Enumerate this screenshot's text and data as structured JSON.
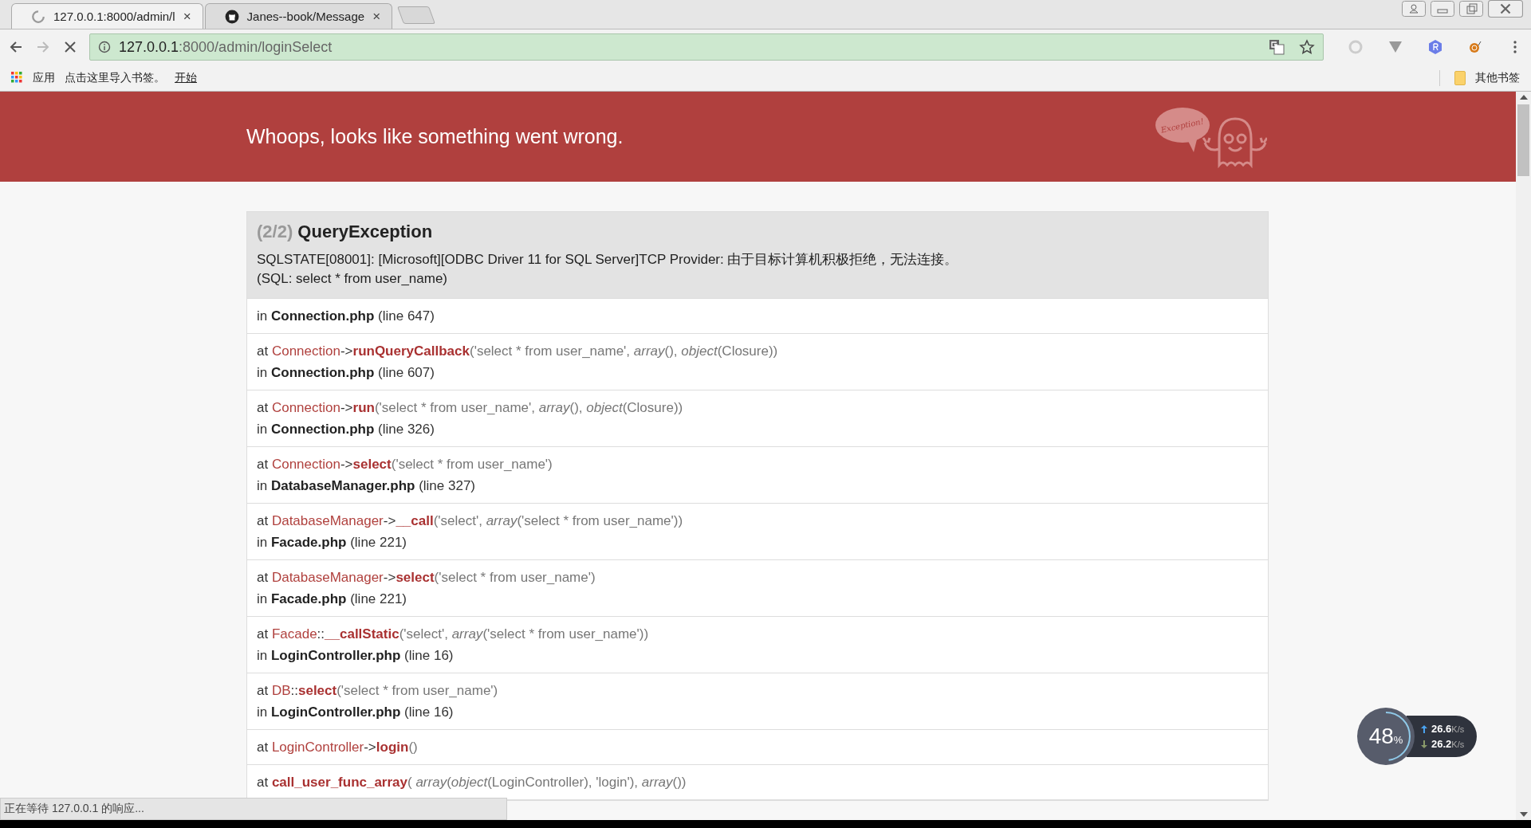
{
  "browser": {
    "tabs": [
      {
        "title": "127.0.0.1:8000/admin/l",
        "close": "×",
        "selected": true,
        "kind": "loading"
      },
      {
        "title": "Janes--book/Message",
        "close": "×",
        "selected": false,
        "kind": "github"
      }
    ],
    "address": {
      "host": "127.0.0.1",
      "path": ":8000/admin/loginSelect"
    },
    "bookmarks": [
      {
        "label": "应用",
        "kind": "apps"
      },
      {
        "label": "点击这里导入书签。",
        "kind": "text"
      },
      {
        "label": "开始",
        "kind": "link"
      }
    ],
    "other_bookmarks": "其他书签",
    "status": "正在等待 127.0.0.1 的响应..."
  },
  "header": {
    "message": "Whoops, looks like something went wrong.",
    "mascot_text": "Exception!"
  },
  "exception": {
    "counter": "(2/2)",
    "name": "QueryException",
    "message": "SQLSTATE[08001]: [Microsoft][ODBC Driver 11 for SQL Server]TCP Provider: 由于目标计算机积极拒绝，无法连接。",
    "sql": "(SQL: select * from user_name)"
  },
  "trace": [
    {
      "location": [
        {
          "text": "in ",
          "kind": "plain"
        },
        {
          "text": "Connection.php",
          "kind": "file"
        },
        {
          "text": " (line 647)",
          "kind": "plain"
        }
      ]
    },
    {
      "call": [
        {
          "text": "at ",
          "kind": "plain"
        },
        {
          "text": "Connection",
          "kind": "class"
        },
        {
          "text": "->",
          "kind": "sep"
        },
        {
          "text": "runQueryCallback",
          "kind": "method"
        },
        {
          "text": "('select * from user_name', ",
          "kind": "args"
        },
        {
          "text": "array",
          "kind": "italic"
        },
        {
          "text": "(), ",
          "kind": "args"
        },
        {
          "text": "object",
          "kind": "italic"
        },
        {
          "text": "(Closure))",
          "kind": "args"
        }
      ],
      "location": [
        {
          "text": "in ",
          "kind": "plain"
        },
        {
          "text": "Connection.php",
          "kind": "file"
        },
        {
          "text": " (line 607)",
          "kind": "plain"
        }
      ]
    },
    {
      "call": [
        {
          "text": "at ",
          "kind": "plain"
        },
        {
          "text": "Connection",
          "kind": "class"
        },
        {
          "text": "->",
          "kind": "sep"
        },
        {
          "text": "run",
          "kind": "method"
        },
        {
          "text": "('select * from user_name', ",
          "kind": "args"
        },
        {
          "text": "array",
          "kind": "italic"
        },
        {
          "text": "(), ",
          "kind": "args"
        },
        {
          "text": "object",
          "kind": "italic"
        },
        {
          "text": "(Closure))",
          "kind": "args"
        }
      ],
      "location": [
        {
          "text": "in ",
          "kind": "plain"
        },
        {
          "text": "Connection.php",
          "kind": "file"
        },
        {
          "text": " (line 326)",
          "kind": "plain"
        }
      ]
    },
    {
      "call": [
        {
          "text": "at ",
          "kind": "plain"
        },
        {
          "text": "Connection",
          "kind": "class"
        },
        {
          "text": "->",
          "kind": "sep"
        },
        {
          "text": "select",
          "kind": "method"
        },
        {
          "text": "('select * from user_name')",
          "kind": "args"
        }
      ],
      "location": [
        {
          "text": "in ",
          "kind": "plain"
        },
        {
          "text": "DatabaseManager.php",
          "kind": "file"
        },
        {
          "text": " (line 327)",
          "kind": "plain"
        }
      ]
    },
    {
      "call": [
        {
          "text": "at ",
          "kind": "plain"
        },
        {
          "text": "DatabaseManager",
          "kind": "class"
        },
        {
          "text": "->",
          "kind": "sep"
        },
        {
          "text": "__call",
          "kind": "method"
        },
        {
          "text": "('select', ",
          "kind": "args"
        },
        {
          "text": "array",
          "kind": "italic"
        },
        {
          "text": "('select * from user_name'))",
          "kind": "args"
        }
      ],
      "location": [
        {
          "text": "in ",
          "kind": "plain"
        },
        {
          "text": "Facade.php",
          "kind": "file"
        },
        {
          "text": " (line 221)",
          "kind": "plain"
        }
      ]
    },
    {
      "call": [
        {
          "text": "at ",
          "kind": "plain"
        },
        {
          "text": "DatabaseManager",
          "kind": "class"
        },
        {
          "text": "->",
          "kind": "sep"
        },
        {
          "text": "select",
          "kind": "method"
        },
        {
          "text": "('select * from user_name')",
          "kind": "args"
        }
      ],
      "location": [
        {
          "text": "in ",
          "kind": "plain"
        },
        {
          "text": "Facade.php",
          "kind": "file"
        },
        {
          "text": " (line 221)",
          "kind": "plain"
        }
      ]
    },
    {
      "call": [
        {
          "text": "at ",
          "kind": "plain"
        },
        {
          "text": "Facade",
          "kind": "class"
        },
        {
          "text": "::",
          "kind": "sep"
        },
        {
          "text": "__callStatic",
          "kind": "method"
        },
        {
          "text": "('select', ",
          "kind": "args"
        },
        {
          "text": "array",
          "kind": "italic"
        },
        {
          "text": "('select * from user_name'))",
          "kind": "args"
        }
      ],
      "location": [
        {
          "text": "in ",
          "kind": "plain"
        },
        {
          "text": "LoginController.php",
          "kind": "file"
        },
        {
          "text": " (line 16)",
          "kind": "plain"
        }
      ]
    },
    {
      "call": [
        {
          "text": "at ",
          "kind": "plain"
        },
        {
          "text": "DB",
          "kind": "class"
        },
        {
          "text": "::",
          "kind": "sep"
        },
        {
          "text": "select",
          "kind": "method"
        },
        {
          "text": "('select * from user_name')",
          "kind": "args"
        }
      ],
      "location": [
        {
          "text": "in ",
          "kind": "plain"
        },
        {
          "text": "LoginController.php",
          "kind": "file"
        },
        {
          "text": " (line 16)",
          "kind": "plain"
        }
      ]
    },
    {
      "call": [
        {
          "text": "at ",
          "kind": "plain"
        },
        {
          "text": "LoginController",
          "kind": "class"
        },
        {
          "text": "->",
          "kind": "sep"
        },
        {
          "text": "login",
          "kind": "method"
        },
        {
          "text": "()",
          "kind": "args"
        }
      ]
    },
    {
      "call": [
        {
          "text": "at  ",
          "kind": "plain"
        },
        {
          "text": "call_user_func_array",
          "kind": "method"
        },
        {
          "text": "( ",
          "kind": "args"
        },
        {
          "text": "array",
          "kind": "italic"
        },
        {
          "text": "(",
          "kind": "args"
        },
        {
          "text": "object",
          "kind": "italic"
        },
        {
          "text": "(LoginController), 'login'), ",
          "kind": "args"
        },
        {
          "text": "array",
          "kind": "italic"
        },
        {
          "text": "())",
          "kind": "args"
        }
      ]
    }
  ],
  "net_widget": {
    "percent": "48",
    "unit": "%",
    "level": 0.48,
    "up": "26.6",
    "up_unit": "K/s",
    "down": "26.2",
    "down_unit": "K/s"
  }
}
